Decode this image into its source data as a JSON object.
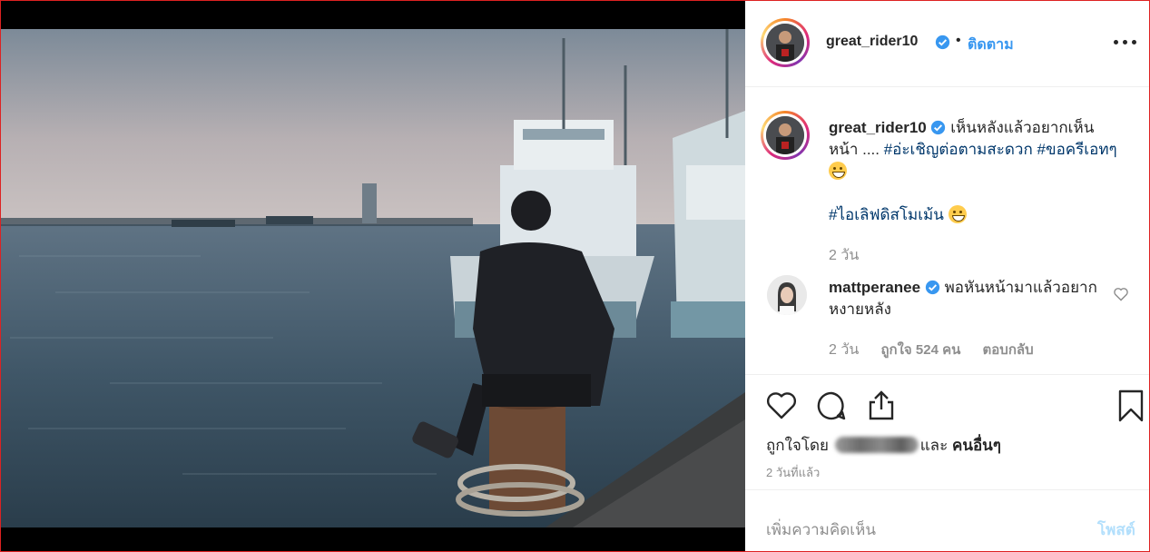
{
  "post": {
    "author": "great_rider10",
    "follow_label": "ติดตาม",
    "dot": "•",
    "more_icon": "more-options-icon"
  },
  "caption": {
    "username": "great_rider10",
    "text_1": " เห็นหลังแล้วอยากเห็นหน้า .... ",
    "hashtag_1": "#อ่ะเชิญต่อตามสะดวก",
    "hashtag_2": "#ขอครีเอทๆ",
    "hashtag_3": "#ไอเลิฟดิสโมเม้น",
    "time": "2 วัน"
  },
  "reply": {
    "username": "mattperanee",
    "text": " พอหันหน้ามาแล้วอยากหงายหลัง",
    "time": "2 วัน",
    "likes_label": "ถูกใจ 524 คน",
    "reply_label": "ตอบกลับ"
  },
  "engagement": {
    "liked_by_prefix": "ถูกใจโดย",
    "and_label": "และ",
    "others_label": "คนอื่นๆ",
    "time_ago": "2 วันที่แล้ว"
  },
  "comment_box": {
    "placeholder": "เพิ่มความคิดเห็น",
    "post_label": "โพสต์"
  },
  "colors": {
    "link_blue": "#3897f0",
    "hashtag": "#00376b",
    "muted": "#8e8e8e",
    "post_disabled": "#b2dffc"
  }
}
